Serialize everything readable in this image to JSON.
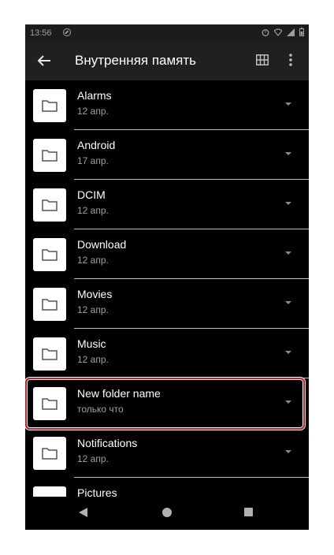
{
  "status_bar": {
    "time": "13:56"
  },
  "app_bar": {
    "title": "Внутренняя память"
  },
  "folders": [
    {
      "name": "Alarms",
      "date": "12 апр."
    },
    {
      "name": "Android",
      "date": "17 апр."
    },
    {
      "name": "DCIM",
      "date": "12 апр."
    },
    {
      "name": "Download",
      "date": "12 апр."
    },
    {
      "name": "Movies",
      "date": "12 апр."
    },
    {
      "name": "Music",
      "date": "12 апр."
    },
    {
      "name": "New folder name",
      "date": "только что"
    },
    {
      "name": "Notifications",
      "date": "12 апр."
    },
    {
      "name": "Pictures",
      "date": ""
    }
  ],
  "highlighted_folder": "New folder name",
  "colors": {
    "highlight": "#c8202a",
    "background": "#000000",
    "app_bar": "#202020"
  }
}
